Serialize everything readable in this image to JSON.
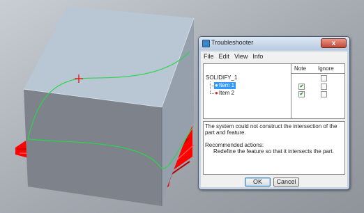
{
  "window": {
    "title": "Troubleshooter",
    "close_symbol": "x",
    "menu": [
      "File",
      "Edit",
      "View",
      "Info"
    ]
  },
  "tree": {
    "columns": {
      "note": "Note",
      "ignore": "Ignore"
    },
    "root": "SOLIDIFY_1",
    "items": [
      {
        "label": "Item 1",
        "selected": true,
        "note_checked": true,
        "ignore_checked": false
      },
      {
        "label": "Item 2",
        "selected": false,
        "note_checked": true,
        "ignore_checked": false
      }
    ]
  },
  "message": {
    "line1": "The system could not construct the intersection of the part and feature.",
    "actions_heading": "Recommended actions:",
    "action": "Redefine the feature so that it intersects the part."
  },
  "buttons": {
    "ok": "OK",
    "cancel": "Cancel"
  },
  "colors": {
    "background": "#a5aab1",
    "cube_top": "#b9c6d4",
    "cube_front": "#7d828b",
    "cube_right": "#96a0ac",
    "failed_geometry": "#ff0000",
    "preview_curve": "#29d64a",
    "pick_marker": "#e8141a"
  }
}
